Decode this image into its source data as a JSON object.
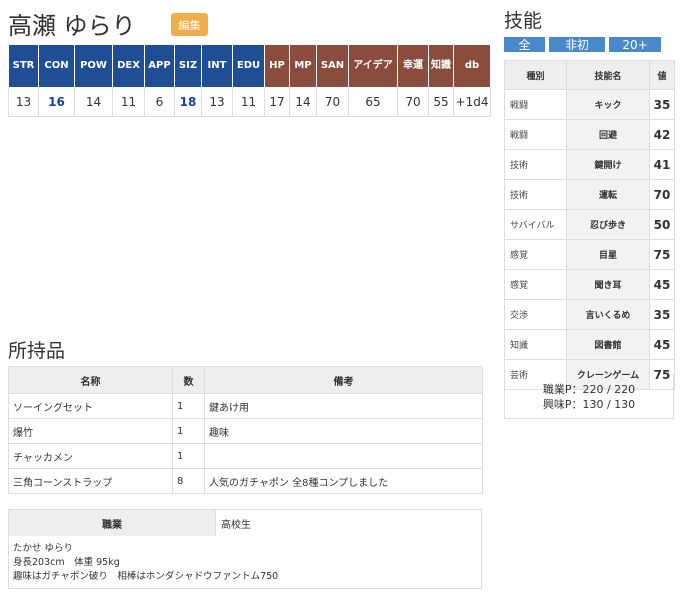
{
  "character": {
    "name": "高瀬 ゆらり",
    "edit_label": "編集"
  },
  "stats": {
    "headers": [
      "STR",
      "CON",
      "POW",
      "DEX",
      "APP",
      "SIZ",
      "INT",
      "EDU",
      "HP",
      "MP",
      "SAN",
      "アイデア",
      "幸運",
      "知識",
      "db"
    ],
    "values": [
      "13",
      "16",
      "14",
      "11",
      "6",
      "18",
      "13",
      "11",
      "17",
      "14",
      "70",
      "65",
      "70",
      "55",
      "+1d4"
    ],
    "highlighted": [
      "CON",
      "SIZ"
    ],
    "colors": {
      "primary": "#1f4e95",
      "derived": "#8a4c3c",
      "highlight_text": "#1d3f9e"
    }
  },
  "inventory": {
    "title": "所持品",
    "headers": [
      "名称",
      "数",
      "備考"
    ],
    "rows": [
      [
        "ソーイングセット",
        "1",
        "鍵あけ用"
      ],
      [
        "爆竹",
        "1",
        "趣味"
      ],
      [
        "チャッカメン",
        "1",
        ""
      ],
      [
        "三角コーンストラップ",
        "8",
        "人気のガチャポン 全8種コンプしました"
      ]
    ]
  },
  "job": {
    "label": "職業",
    "value": "高校生",
    "description": [
      "たかせ ゆらり",
      "身長203cm　体重 95kg",
      "趣味はガチャポン破り　相棒はホンダシャドウファントム750"
    ]
  },
  "skills": {
    "title": "技能",
    "filters": [
      "全",
      "非初",
      "20+"
    ],
    "headers": [
      "種別",
      "技能名",
      "値"
    ],
    "rows": [
      [
        "戦闘",
        "キック",
        "35"
      ],
      [
        "戦闘",
        "回避",
        "42"
      ],
      [
        "技術",
        "鍵開け",
        "41"
      ],
      [
        "技術",
        "運転",
        "70"
      ],
      [
        "サバイバル",
        "忍び歩き",
        "50"
      ],
      [
        "感覚",
        "目星",
        "75"
      ],
      [
        "感覚",
        "聞き耳",
        "45"
      ],
      [
        "交渉",
        "言いくるめ",
        "35"
      ],
      [
        "知識",
        "図書館",
        "45"
      ],
      [
        "芸術",
        "クレーンゲーム",
        "75"
      ]
    ],
    "job_points": "職業P：220 / 220",
    "interest_points": "興味P：130 / 130"
  }
}
